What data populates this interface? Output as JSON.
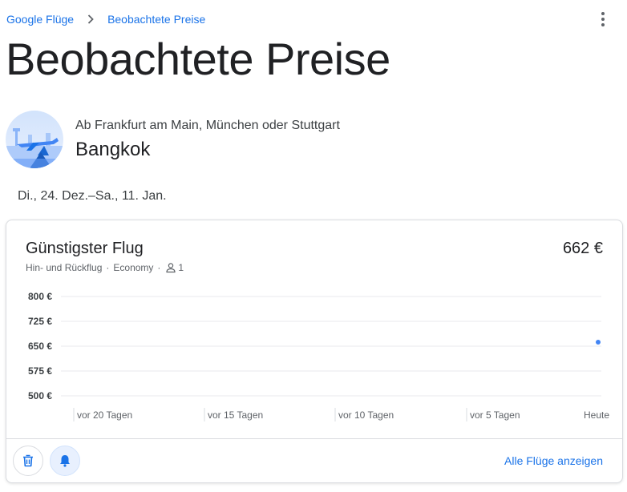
{
  "breadcrumb": {
    "root": "Google Flüge",
    "current": "Beobachtete Preise"
  },
  "page": {
    "title": "Beobachtete Preise"
  },
  "destination": {
    "origin": "Ab Frankfurt am Main, München oder Stuttgart",
    "city": "Bangkok"
  },
  "dates": "Di., 24. Dez.–Sa., 11. Jan.",
  "card": {
    "title": "Günstigster Flug",
    "price": "662 €",
    "trip_type": "Hin- und Rückflug",
    "separator": "·",
    "cabin": "Economy",
    "passengers": "1",
    "all_flights_label": "Alle Flüge anzeigen"
  },
  "colors": {
    "link": "#1a73e8",
    "point": "#4285f4",
    "grid": "#e8eaed"
  },
  "icons": {
    "breadcrumb_separator": "chevron-right-icon",
    "more": "more-vert-icon",
    "passenger": "person-icon",
    "delete": "trash-icon",
    "alert": "bell-icon"
  },
  "chart_data": {
    "type": "scatter",
    "y_tick_labels": [
      "800 €",
      "725 €",
      "650 €",
      "575 €",
      "500 €"
    ],
    "y_ticks": [
      800,
      725,
      650,
      575,
      500
    ],
    "ylim": [
      500,
      800
    ],
    "x_tick_labels": [
      "vor 20 Tagen",
      "vor 15 Tagen",
      "vor 10 Tagen",
      "vor 5 Tagen",
      "Heute"
    ],
    "x_ticks": [
      -20,
      -15,
      -10,
      -5,
      0
    ],
    "xlim": [
      -20,
      0
    ],
    "grid": true,
    "series": [
      {
        "points": [
          {
            "x": 0,
            "y": 662
          }
        ]
      }
    ]
  }
}
